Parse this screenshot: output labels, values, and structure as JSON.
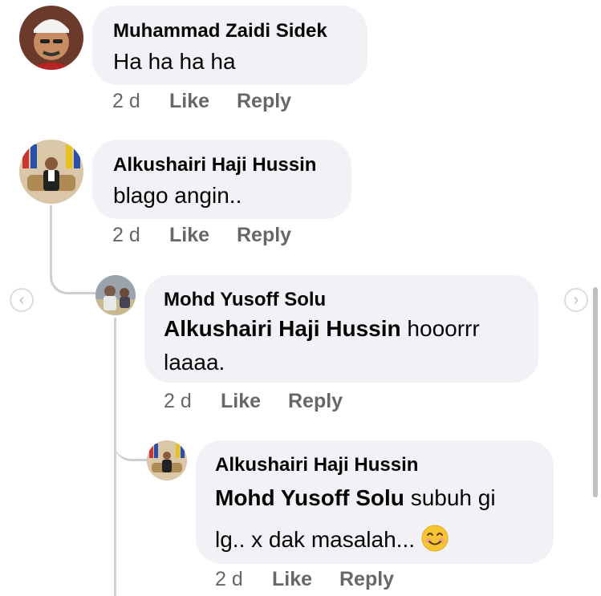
{
  "comments": [
    {
      "author": "Muhammad Zaidi Sidek",
      "text": "Ha ha ha ha",
      "time": "2 d",
      "like": "Like",
      "reply": "Reply"
    },
    {
      "author": "Alkushairi Haji Hussin",
      "text": "blago angin..",
      "time": "2 d",
      "like": "Like",
      "reply": "Reply"
    },
    {
      "author": "Mohd Yusoff Solu",
      "mention": "Alkushairi Haji Hussin",
      "text_line1": " hooorrr",
      "text_line2": "laaaa.",
      "time": "2 d",
      "like": "Like",
      "reply": "Reply"
    },
    {
      "author": "Alkushairi Haji Hussin",
      "mention": "Mohd Yusoff Solu",
      "text_line1": " subuh gi",
      "text_line2": "lg.. x dak masalah... ",
      "emoji": "smiling-face-emoji",
      "time": "2 d",
      "like": "Like",
      "reply": "Reply"
    }
  ],
  "nav": {
    "prev_icon": "chevron-left-icon",
    "next_icon": "chevron-right-icon"
  },
  "colors": {
    "bubble": "#f0f2f5",
    "meta": "#65676b",
    "line": "#ccd0d5"
  }
}
